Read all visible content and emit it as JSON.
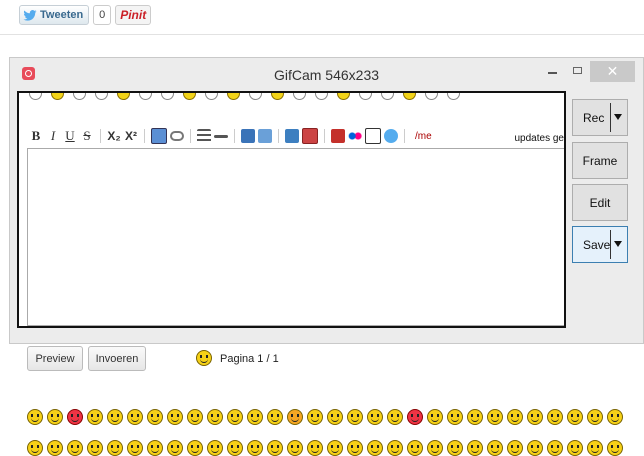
{
  "social": {
    "tweet_label": "Tweeten",
    "tweet_count": "0",
    "pin_label": "Pinit"
  },
  "window": {
    "title": "GifCam 546x233",
    "close_glyph": "✕"
  },
  "editor": {
    "toolbar": {
      "bold": "B",
      "italic": "I",
      "underline": "U",
      "strike": "S",
      "subscript": "X₂",
      "superscript": "X²",
      "me": "/me"
    },
    "updates_text": "updates ge"
  },
  "side_buttons": {
    "rec": "Rec",
    "frame": "Frame",
    "edit": "Edit",
    "save": "Save"
  },
  "form": {
    "preview_label": "Preview",
    "invoeren_label": "Invoeren",
    "pagina": "Pagina 1 / 1"
  },
  "colors": {
    "accent": "#3c7fb1",
    "app_icon": "#e84b5a",
    "smiley": "#f6d117"
  }
}
